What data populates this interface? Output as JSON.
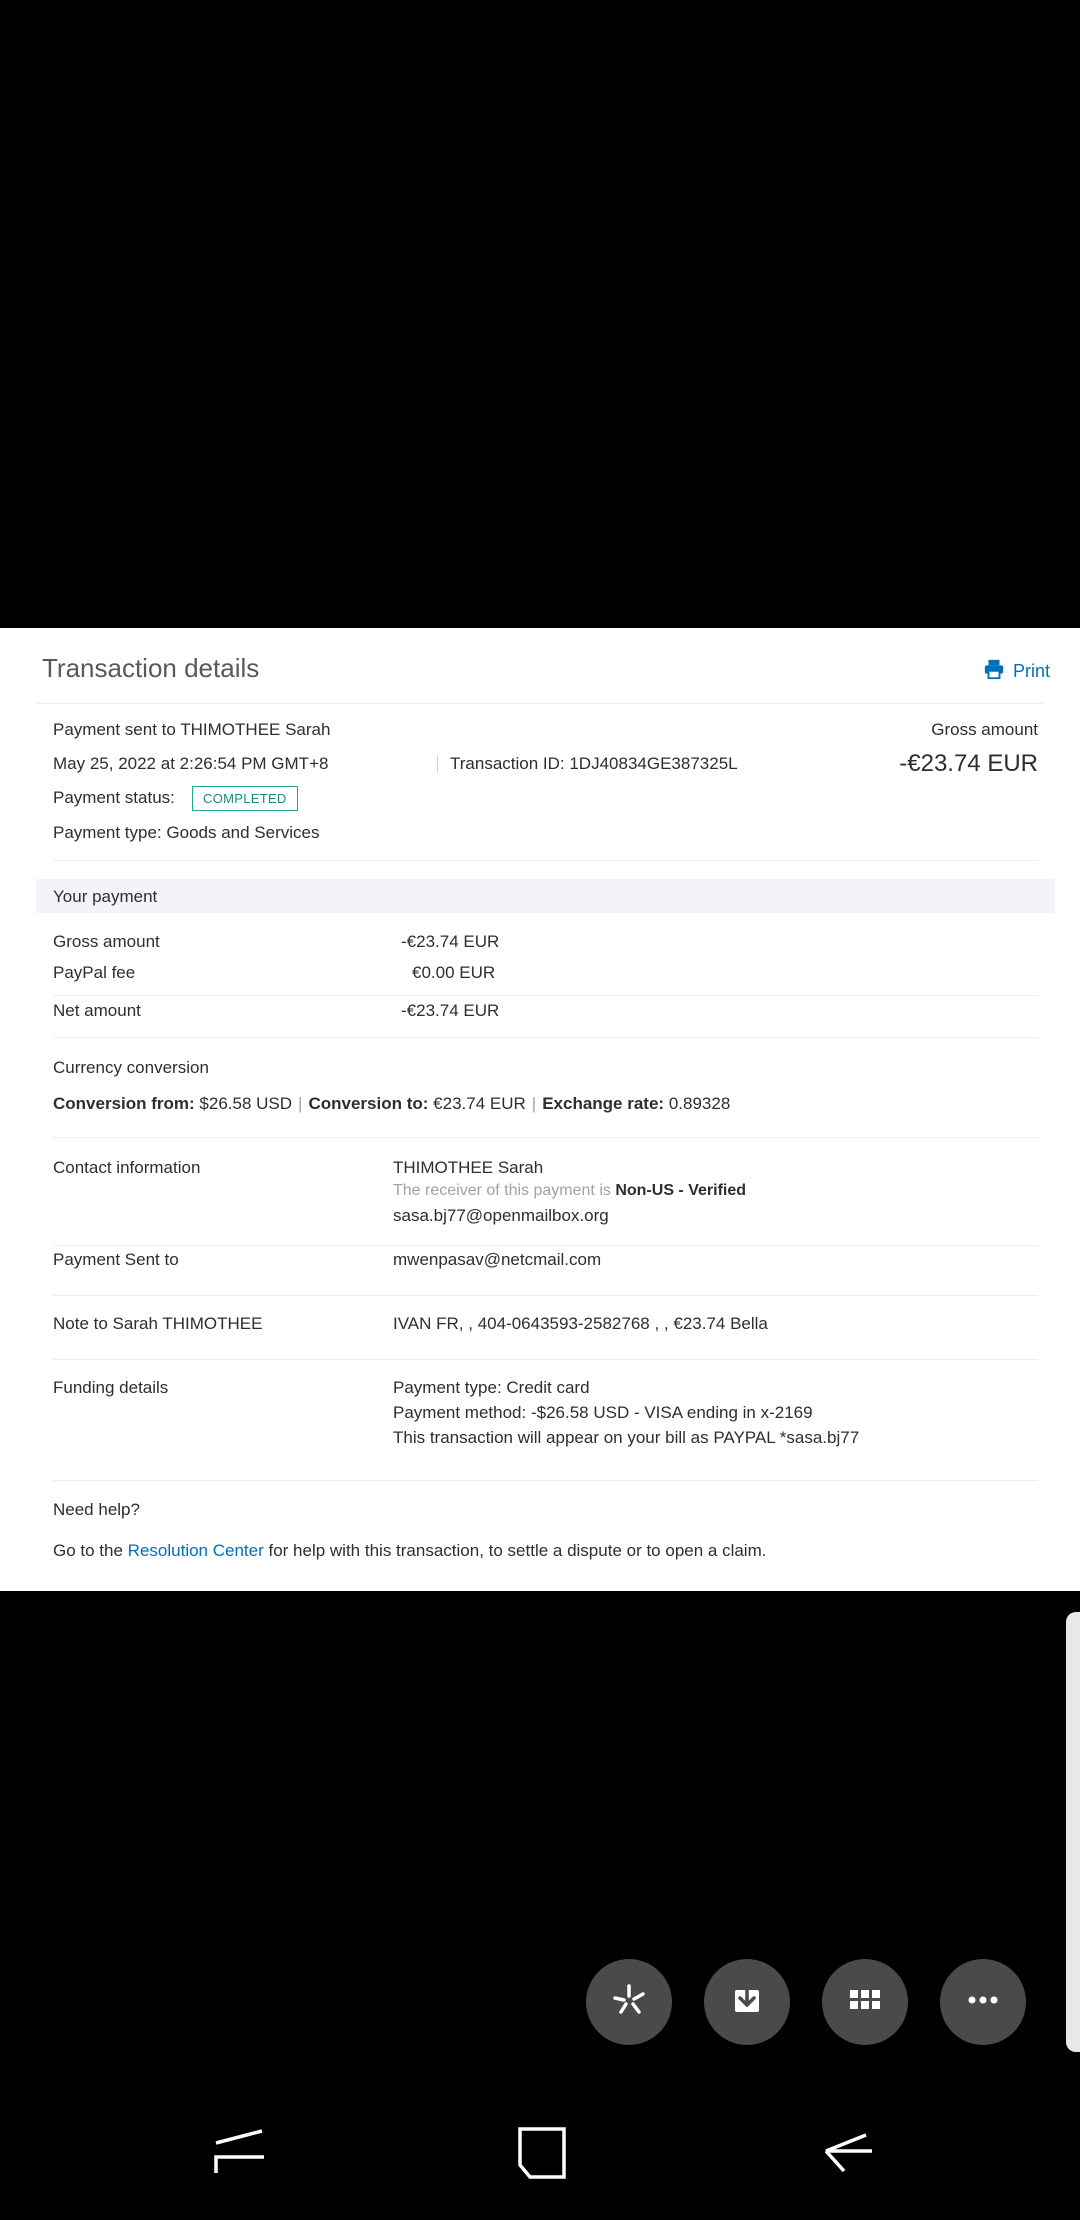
{
  "panel": {
    "title": "Transaction details",
    "print_label": "Print"
  },
  "summary": {
    "recipient": "Payment sent to THIMOTHEE Sarah",
    "datetime": "May 25, 2022 at 2:26:54 PM GMT+8",
    "transaction_id": "Transaction ID: 1DJ40834GE387325L",
    "status_label": "Payment status:",
    "status_value": "COMPLETED",
    "payment_type": "Payment type: Goods and Services",
    "gross_label": "Gross amount",
    "gross_value": "-€23.74 EUR"
  },
  "your_payment": {
    "heading": "Your payment",
    "rows": [
      {
        "label": "Gross amount",
        "value": "-€23.74 EUR"
      },
      {
        "label": "PayPal fee",
        "value": "€0.00 EUR"
      },
      {
        "label": "Net amount",
        "value": "-€23.74 EUR"
      }
    ]
  },
  "currency": {
    "heading": "Currency conversion",
    "from_label": "Conversion from:",
    "from_value": "$26.58 USD",
    "to_label": "Conversion to:",
    "to_value": "€23.74 EUR",
    "rate_label": "Exchange rate:",
    "rate_value": "0.89328"
  },
  "contact": {
    "label": "Contact information",
    "name": "THIMOTHEE Sarah",
    "verify_prefix": "The receiver of this payment is",
    "verify_status": "Non-US - Verified",
    "email": "sasa.bj77@openmailbox.org"
  },
  "sent_to": {
    "label": "Payment Sent to",
    "value": "mwenpasav@netcmail.com"
  },
  "note": {
    "label": "Note to Sarah THIMOTHEE",
    "value": "IVAN FR, , 404-0643593-2582768 ,   , €23.74 Bella"
  },
  "funding": {
    "label": "Funding details",
    "type": "Payment type: Credit card",
    "method": "Payment method: -$26.58 USD - VISA ending in x-2169",
    "bill": "This transaction will appear on your bill as PAYPAL *sasa.bj77"
  },
  "help": {
    "heading": "Need help?",
    "prefix": "Go to the",
    "link": "Resolution Center",
    "suffix": "for help with this transaction, to settle a dispute or to open a claim."
  },
  "toolbar": {
    "buttons": [
      "capture-icon",
      "save-download-icon",
      "apps-grid-icon",
      "more-icon"
    ]
  },
  "colors": {
    "link": "#0070ba",
    "status_border": "#2aa78f",
    "band": "#f2f4f7"
  }
}
